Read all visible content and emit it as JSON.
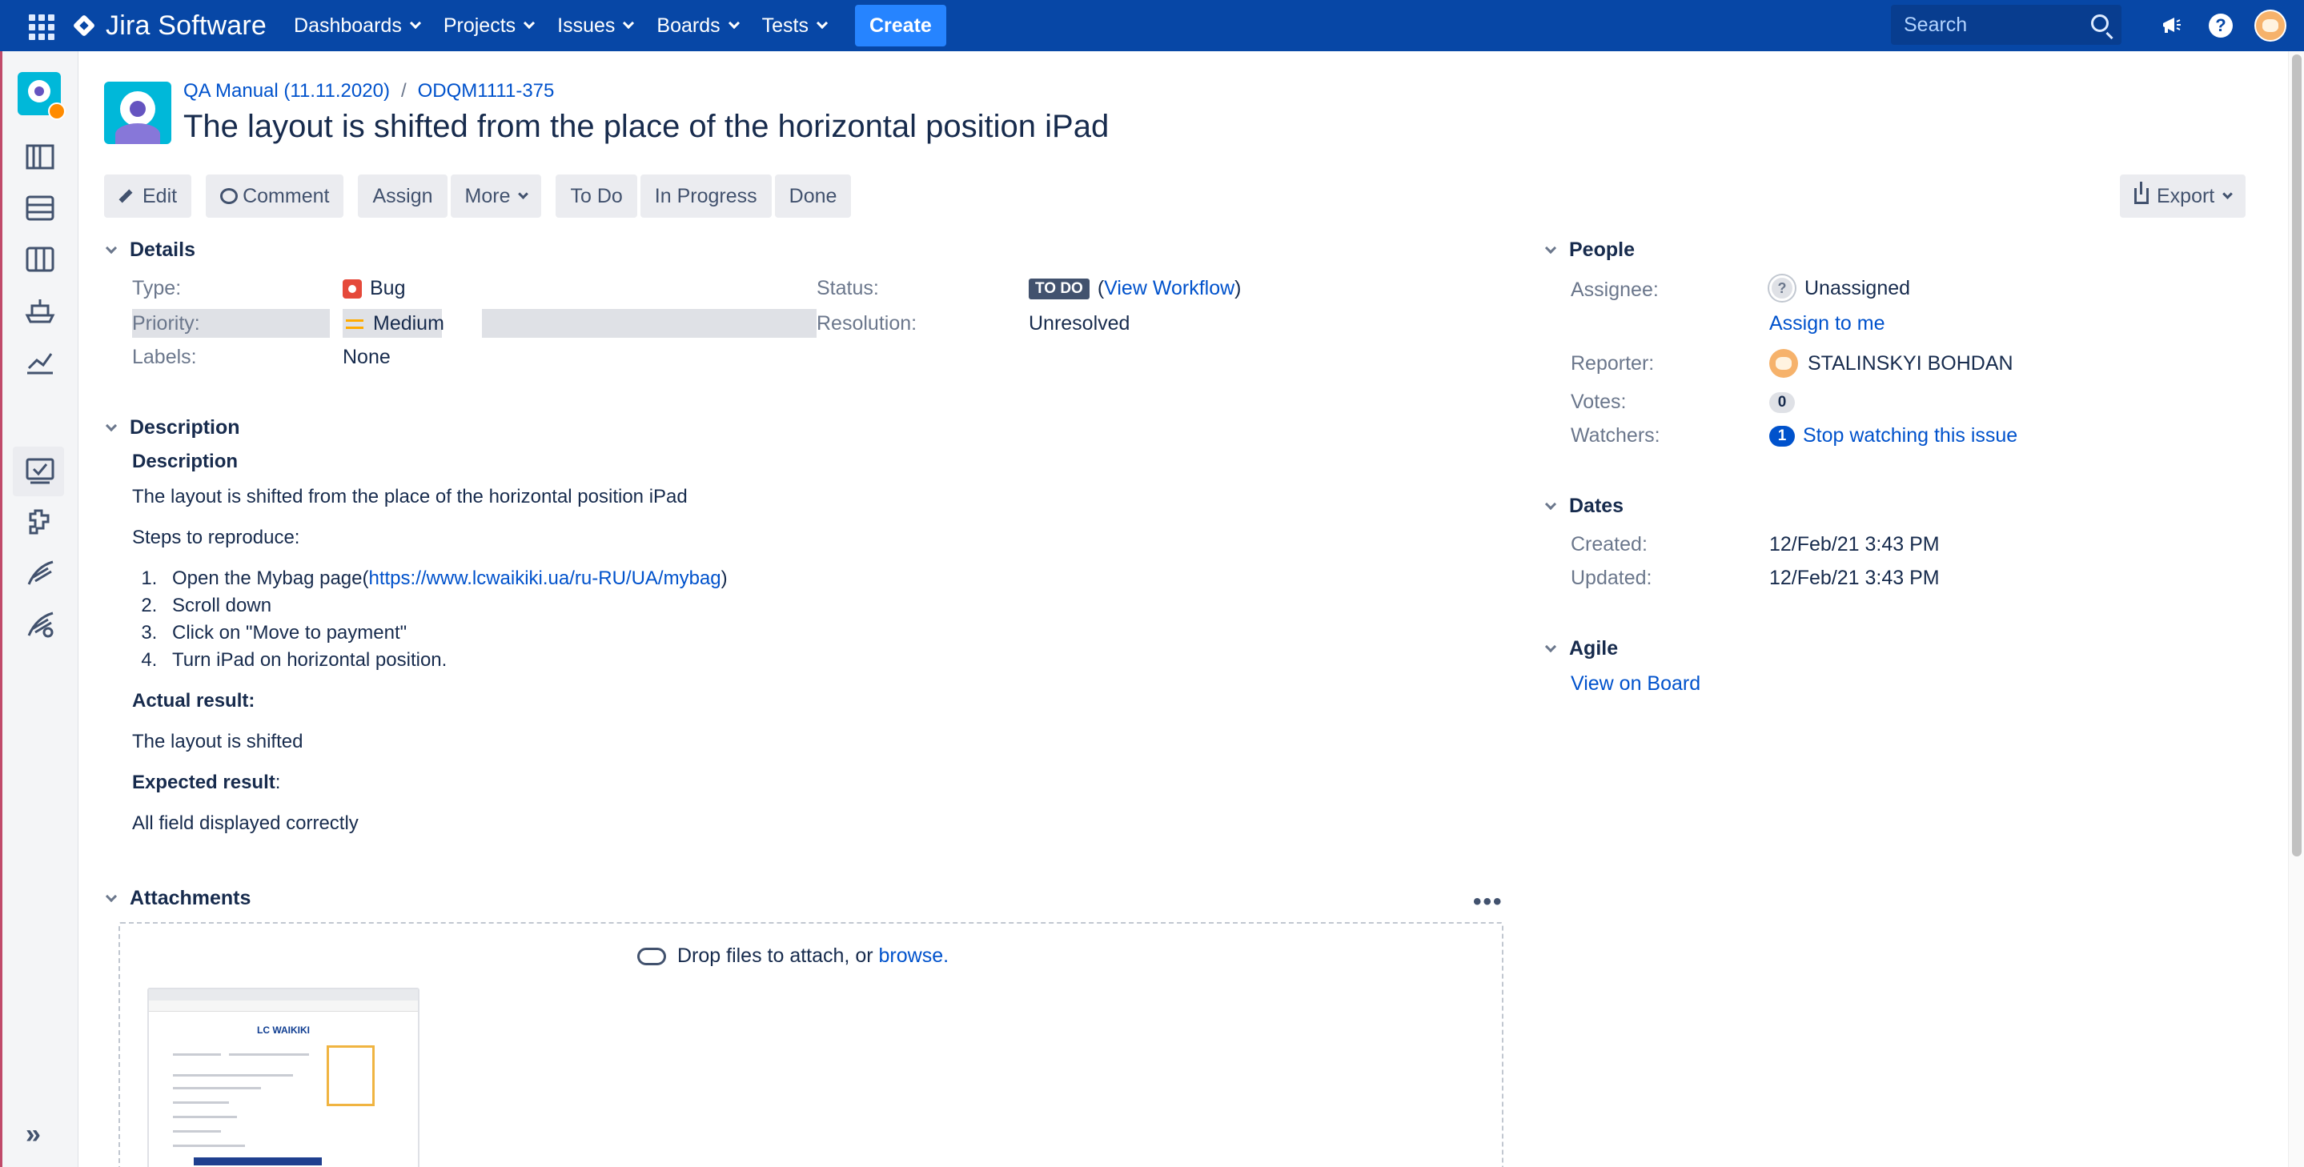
{
  "nav": {
    "product": "Jira Software",
    "menu": [
      "Dashboards",
      "Projects",
      "Issues",
      "Boards",
      "Tests"
    ],
    "create": "Create",
    "search_placeholder": "Search",
    "help": "?"
  },
  "sidebar": {
    "icons": [
      "roadmap-icon",
      "backlog-icon",
      "board-icon",
      "releases-icon",
      "reports-icon",
      "tests-icon",
      "add-ons-icon",
      "test-tool-icon",
      "test-tool-2-icon"
    ],
    "expand": "»"
  },
  "breadcrumb": {
    "project": "QA Manual (11.11.2020)",
    "sep": "/",
    "key": "ODQM1111-375"
  },
  "issue": {
    "title": "The layout is shifted from the place of the horizontal position iPad"
  },
  "toolbar": {
    "edit": "Edit",
    "comment": "Comment",
    "assign": "Assign",
    "more": "More",
    "todo": "To Do",
    "inprogress": "In Progress",
    "done": "Done",
    "export": "Export"
  },
  "details": {
    "heading": "Details",
    "type_label": "Type:",
    "type": "Bug",
    "priority_label": "Priority:",
    "priority": "Medium",
    "labels_label": "Labels:",
    "labels": "None",
    "status_label": "Status:",
    "status": "TO DO",
    "view_workflow": "View Workflow",
    "paren_open": "(",
    "paren_close": ")",
    "resolution_label": "Resolution:",
    "resolution": "Unresolved"
  },
  "description": {
    "heading": "Description",
    "subheading": "Description",
    "intro": "The layout is shifted from the place of the horizontal position iPad",
    "steps_title": "Steps to reproduce:",
    "step1_prefix": "Open the Mybag page(",
    "step1_link": "https://www.lcwaikiki.ua/ru-RU/UA/mybag",
    "step1_suffix": ")",
    "step2": "Scroll down",
    "step3": "Click on \"Move to payment\"",
    "step4": "Turn iPad on horizontal position.",
    "actual_title": "Actual result:",
    "actual": "The layout is shifted",
    "expected_title": "Expected result",
    "expected_colon": ":",
    "expected": "All field displayed correctly"
  },
  "attachments": {
    "heading": "Attachments",
    "menu": "•••",
    "drop": "Drop files to attach, or",
    "browse": "browse.",
    "thumb_brand": "LC WAIKIKI"
  },
  "people": {
    "heading": "People",
    "assignee_label": "Assignee:",
    "assignee": "Unassigned",
    "assign_me": "Assign to me",
    "reporter_label": "Reporter:",
    "reporter": "STALINSKYI BOHDAN",
    "votes_label": "Votes:",
    "votes": "0",
    "watchers_label": "Watchers:",
    "watchers": "1",
    "stop_watching": "Stop watching this issue"
  },
  "dates": {
    "heading": "Dates",
    "created_label": "Created:",
    "created": "12/Feb/21 3:43 PM",
    "updated_label": "Updated:",
    "updated": "12/Feb/21 3:43 PM"
  },
  "agile": {
    "heading": "Agile",
    "view_board": "View on Board"
  }
}
